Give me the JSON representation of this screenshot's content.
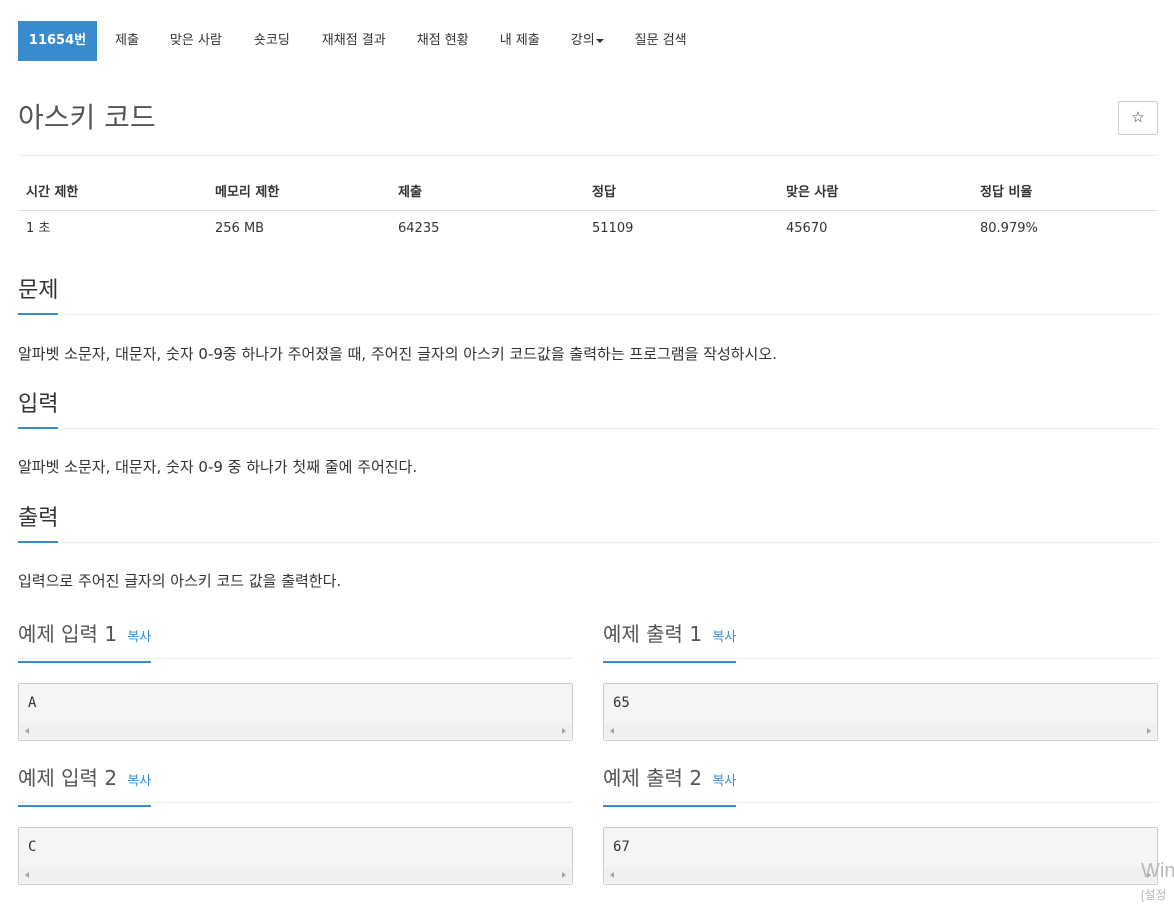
{
  "nav": {
    "items": [
      {
        "label": "11654번",
        "active": true
      },
      {
        "label": "제출"
      },
      {
        "label": "맞은 사람"
      },
      {
        "label": "숏코딩"
      },
      {
        "label": "재채점 결과"
      },
      {
        "label": "채점 현황"
      },
      {
        "label": "내 제출"
      },
      {
        "label": "강의",
        "dropdown": true
      },
      {
        "label": "질문 검색"
      }
    ]
  },
  "problem": {
    "title": "아스키 코드",
    "star_icon": "☆"
  },
  "info_table": {
    "headers": [
      "시간 제한",
      "메모리 제한",
      "제출",
      "정답",
      "맞은 사람",
      "정답 비율"
    ],
    "values": [
      "1 초",
      "256 MB",
      "64235",
      "51109",
      "45670",
      "80.979%"
    ]
  },
  "sections": {
    "description": {
      "heading": "문제",
      "text": "알파벳 소문자, 대문자, 숫자 0-9중 하나가 주어졌을 때, 주어진 글자의 아스키 코드값을 출력하는 프로그램을 작성하시오."
    },
    "input": {
      "heading": "입력",
      "text": "알파벳 소문자, 대문자, 숫자 0-9 중 하나가 첫째 줄에 주어진다."
    },
    "output": {
      "heading": "출력",
      "text": "입력으로 주어진 글자의 아스키 코드 값을 출력한다."
    }
  },
  "samples": {
    "copy_label": "복사",
    "in1": {
      "heading": "예제 입력 1",
      "value": "A"
    },
    "out1": {
      "heading": "예제 출력 1",
      "value": "65"
    },
    "in2": {
      "heading": "예제 입력 2",
      "value": "C"
    },
    "out2": {
      "heading": "예제 출력 2",
      "value": "67"
    }
  },
  "watermark": {
    "line1": "Win",
    "line2": "[설정"
  },
  "colors": {
    "accent": "#3a8bcd"
  }
}
